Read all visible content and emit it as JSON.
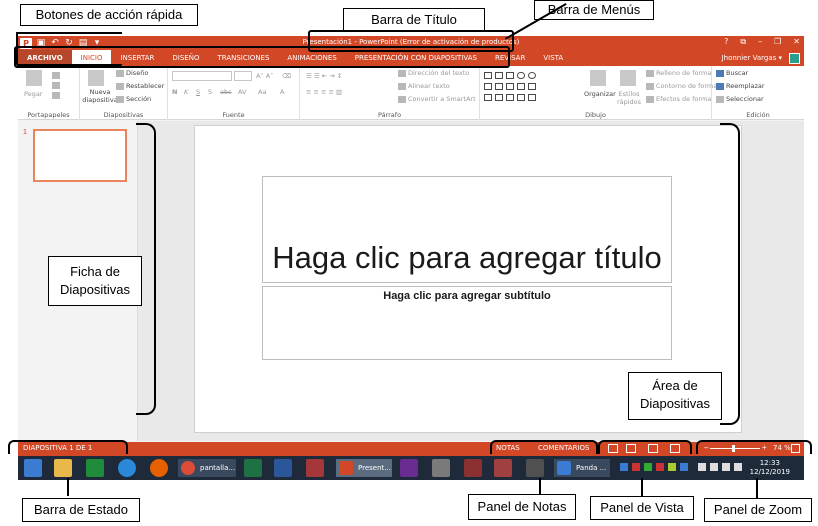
{
  "window": {
    "title": "Presentación1 - PowerPoint (Error de activación de productos)",
    "controls": [
      "?",
      "⧉",
      "–",
      "❐",
      "✕"
    ],
    "user": "Jhonnier Vargas ▾",
    "accent_color": "#d24726"
  },
  "quick_access": {
    "items": [
      "ppt-logo",
      "save-icon",
      "undo-icon",
      "redo-icon",
      "start-from-beginning-icon",
      "customize-icon"
    ]
  },
  "tabs": [
    {
      "label": "ARCHIVO"
    },
    {
      "label": "INICIO",
      "active": true
    },
    {
      "label": "INSERTAR"
    },
    {
      "label": "DISEÑO"
    },
    {
      "label": "TRANSICIONES"
    },
    {
      "label": "ANIMACIONES"
    },
    {
      "label": "PRESENTACIÓN CON DIAPOSITIVAS"
    },
    {
      "label": "REVISAR"
    },
    {
      "label": "VISTA"
    }
  ],
  "ribbon": {
    "portapapeles": {
      "label": "Portapapeles",
      "paste": "Pegar"
    },
    "diapositivas": {
      "label": "Diapositivas",
      "new_slide": "Nueva diapositiva",
      "layout": "Diseño",
      "reset": "Restablecer",
      "section": "Sección"
    },
    "fuente": {
      "label": "Fuente",
      "bold": "N",
      "italic": "K",
      "underline": "S",
      "strike": "S",
      "abc": "abc",
      "av": "AV",
      "aa": "Aa"
    },
    "parrafo": {
      "label": "Párrafo",
      "text_direction": "Dirección del texto",
      "align_text": "Alinear texto",
      "smartart": "Convertir a SmartArt"
    },
    "dibujo": {
      "label": "Dibujo",
      "arrange": "Organizar",
      "quick_styles": "Estilos rápidos",
      "fill": "Relleno de forma",
      "outline": "Contorno de forma",
      "effects": "Efectos de forma"
    },
    "edicion": {
      "label": "Edición",
      "find": "Buscar",
      "replace": "Reemplazar",
      "select": "Seleccionar"
    }
  },
  "thumbnails": {
    "number": "1"
  },
  "slide": {
    "title_placeholder": "Haga clic para agregar título",
    "subtitle_placeholder": "Haga clic para agregar subtítulo"
  },
  "statusbar": {
    "slide_info": "DIAPOSITIVA 1 DE 1",
    "notes": "NOTAS",
    "comments": "COMENTARIOS",
    "zoom": "74 %"
  },
  "taskbar": {
    "apps": [
      "pantalla...",
      "Present...",
      "Panda ..."
    ],
    "time": "12:33",
    "date": "12/12/2019"
  },
  "annotations": {
    "botones": "Botones de acción rápida",
    "barra_titulo": "Barra de Título",
    "barra_menus": "Barra de Menús",
    "ficha": "Ficha de Diapositivas",
    "area": "Área de Diapositivas",
    "estado": "Barra de Estado",
    "notas": "Panel de Notas",
    "vista": "Panel de Vista",
    "zoom": "Panel de Zoom"
  }
}
